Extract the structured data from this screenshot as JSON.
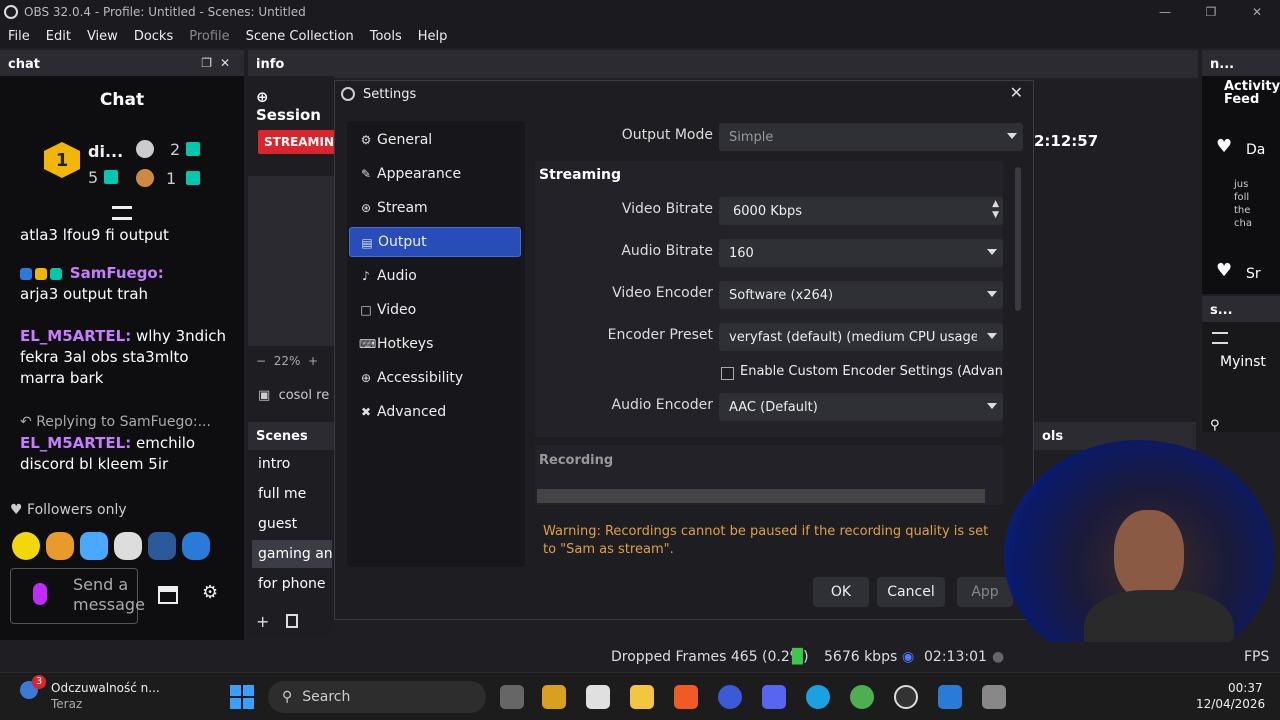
{
  "window": {
    "title": "OBS 32.0.4 - Profile: Untitled - Scenes: Untitled"
  },
  "menu": [
    "File",
    "Edit",
    "View",
    "Docks",
    "Profile",
    "Scene Collection",
    "Tools",
    "Help"
  ],
  "docks": {
    "chat": "chat",
    "info": "info",
    "activity_short": "n...",
    "tools_short": "s..."
  },
  "chat": {
    "title": "Chat",
    "leaderboard": {
      "first_name": "di...",
      "first_rank": "1",
      "first_count": "5",
      "second_count": "2",
      "third_count": "1"
    },
    "messages": [
      {
        "user": "",
        "text": "atla3 lfou9 fi output"
      },
      {
        "user": "SamFuego:",
        "text": "arja3 output trah",
        "color": "#c77dff"
      },
      {
        "user": "EL_M5ARTEL:",
        "text": "wlhy 3ndich fekra 3al obs sta3mlto marra bark",
        "color": "#c77dff"
      },
      {
        "reply": "Replying to SamFuego:...",
        "user": "EL_M5ARTEL:",
        "text": "emchilo discord bl kleem 5ir",
        "color": "#c77dff"
      }
    ],
    "followers_only": "Followers only",
    "send_placeholder": "Send a message"
  },
  "info_panel": {
    "session": "Session",
    "streaming_badge": "STREAMING",
    "time": "2:12:57",
    "zoom": "22%",
    "source": "cosol re"
  },
  "scenes": {
    "title": "Scenes",
    "items": [
      "intro",
      "full me",
      "guest",
      "gaming and",
      "for phone"
    ],
    "selected_index": 3,
    "tools_label": "ols"
  },
  "settings": {
    "title": "Settings",
    "nav": [
      {
        "label": "General",
        "icon": "gear-icon"
      },
      {
        "label": "Appearance",
        "icon": "paint-icon"
      },
      {
        "label": "Stream",
        "icon": "antenna-icon"
      },
      {
        "label": "Output",
        "icon": "output-icon"
      },
      {
        "label": "Audio",
        "icon": "speaker-icon"
      },
      {
        "label": "Video",
        "icon": "monitor-icon"
      },
      {
        "label": "Hotkeys",
        "icon": "keyboard-icon"
      },
      {
        "label": "Accessibility",
        "icon": "accessibility-icon"
      },
      {
        "label": "Advanced",
        "icon": "tools-icon"
      }
    ],
    "selected_nav": "Output",
    "output_mode_label": "Output Mode",
    "output_mode_value": "Simple",
    "streaming_section": "Streaming",
    "video_bitrate_label": "Video Bitrate",
    "video_bitrate_value": "6000 Kbps",
    "audio_bitrate_label": "Audio Bitrate",
    "audio_bitrate_value": "160",
    "video_encoder_label": "Video Encoder",
    "video_encoder_value": "Software (x264)",
    "encoder_preset_label": "Encoder Preset",
    "encoder_preset_value": "veryfast (default) (medium CPU usage, sta",
    "custom_encoder_label": "Enable Custom Encoder Settings (Advanced",
    "audio_encoder_label": "Audio Encoder",
    "audio_encoder_value": "AAC (Default)",
    "recording_section": "Recording",
    "warning": "Warning: Recordings cannot be paused if the recording quality is set to \"Sam as stream\".",
    "ok": "OK",
    "cancel": "Cancel",
    "apply": "App"
  },
  "activity": {
    "title": "Activity Feed",
    "row1": "Da",
    "row2": "Sr",
    "snippet": "jus foll the cha",
    "side": "Myinst"
  },
  "statusbar": {
    "dropped": "Dropped Frames 465 (0.2%)",
    "kbps": "5676 kbps",
    "time": "02:13:01",
    "fps": "FPS"
  },
  "taskbar": {
    "notif_title": "Odczuwalność n...",
    "notif_sub": "Teraz",
    "notif_count": "3",
    "search": "Search",
    "clock_time": "00:37",
    "clock_date": "12/04/2026"
  },
  "colors": {
    "accent": "#284cb8",
    "streaming_red": "#d9252b",
    "warning": "#e0a040",
    "twitch_purple": "#9146ff"
  }
}
